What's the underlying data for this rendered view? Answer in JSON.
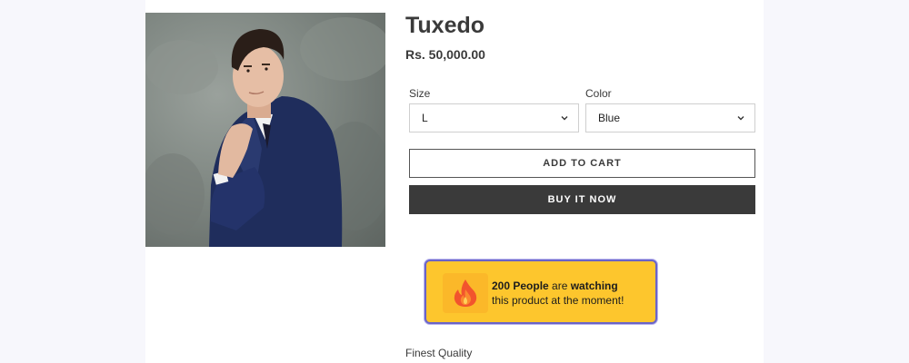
{
  "product": {
    "title": "Tuxedo",
    "price": "Rs. 50,000.00",
    "image_icon": "product-photo"
  },
  "options": {
    "size": {
      "label": "Size",
      "value": "L"
    },
    "color": {
      "label": "Color",
      "value": "Blue"
    }
  },
  "buttons": {
    "add_to_cart": "ADD TO CART",
    "buy_now": "BUY IT NOW"
  },
  "watching": {
    "count_text": "200 People",
    "are_text": " are ",
    "watching_text": "watching",
    "line2": "this product at the moment!",
    "icon": "fire-icon",
    "background_color": "#fdc62d",
    "border_color": "#6a64c8"
  },
  "description": {
    "first_line": "Finest Quality"
  }
}
